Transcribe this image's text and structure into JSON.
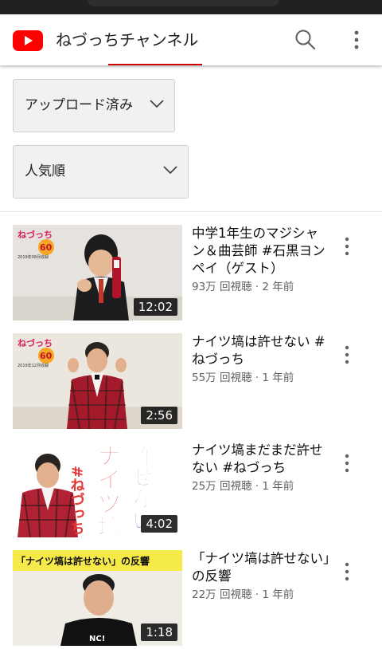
{
  "header": {
    "channel_name": "ねづっちチャンネル",
    "accent_color": "#cc0000",
    "logo_icon": "youtube-logo-icon",
    "search_icon": "search-icon",
    "more_icon": "more-vert-icon"
  },
  "filters": {
    "upload_filter": "アップロード済み",
    "sort_filter": "人気順"
  },
  "videos": [
    {
      "title": "中学1年生のマジシャン＆曲芸師 #石黒ヨンペイ（ゲスト）",
      "meta": "93万 回視聴 · 2 年前",
      "duration": "12:02",
      "badge_text": "ねづっち",
      "badge_number": "60",
      "badge_date": "2019年08月收録"
    },
    {
      "title": "ナイツ塙は許せない #ねづっち",
      "meta": "55万 回視聴 · 1 年前",
      "duration": "2:56",
      "badge_text": "ねづっち",
      "badge_number": "60",
      "badge_date": "2019年12月收録"
    },
    {
      "title": "ナイツ塙まだまだ許せない #ねづっち",
      "meta": "25万 回視聴 · 1 年前",
      "duration": "4:02",
      "art_col1": "許せない",
      "art_col2": "ナイツ塙",
      "art_col3": "#ねづっち"
    },
    {
      "title": "「ナイツ塙は許せない」の反響",
      "meta": "22万 回視聴 · 1 年前",
      "duration": "1:18",
      "banner": "「ナイツ塙は許せない」の反響",
      "shirt_text": "NC!"
    }
  ]
}
